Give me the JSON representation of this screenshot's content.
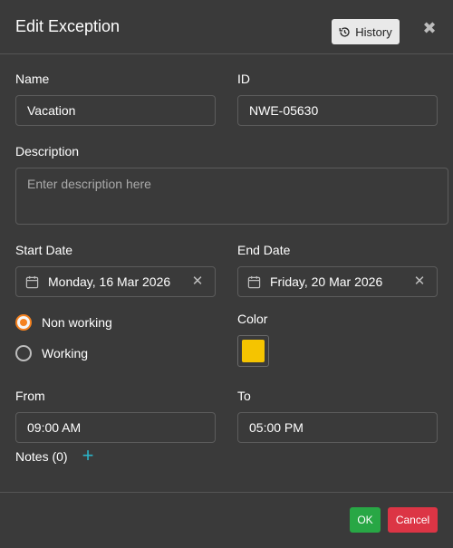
{
  "dialog": {
    "title": "Edit Exception",
    "history_label": "History"
  },
  "name": {
    "label": "Name",
    "value": "Vacation"
  },
  "id": {
    "label": "ID",
    "value": "NWE-05630"
  },
  "description": {
    "label": "Description",
    "value": "",
    "placeholder": "Enter description here"
  },
  "start_date": {
    "label": "Start Date",
    "value": "Monday, 16 Mar 2026"
  },
  "end_date": {
    "label": "End Date",
    "value": "Friday, 20 Mar 2026"
  },
  "day_type": {
    "options": [
      "Non working",
      "Working"
    ],
    "selected": "Non working"
  },
  "color": {
    "label": "Color",
    "value": "#f5c400"
  },
  "from": {
    "label": "From",
    "value": "09:00 AM"
  },
  "to": {
    "label": "To",
    "value": "05:00 PM"
  },
  "notes": {
    "label": "Notes (0)"
  },
  "footer": {
    "ok_label": "OK",
    "cancel_label": "Cancel"
  },
  "colors": {
    "accent": "#f58220",
    "ok": "#28a745",
    "cancel": "#dc3545",
    "add": "#2bb3c7"
  },
  "icons": [
    "history-icon",
    "close-icon",
    "calendar-icon",
    "clear-icon",
    "plus-icon"
  ]
}
